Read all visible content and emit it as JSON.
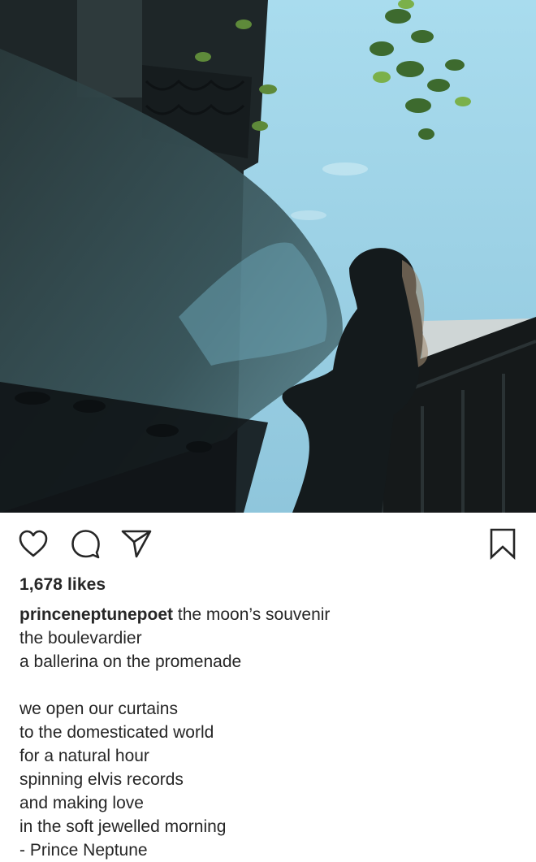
{
  "post": {
    "image_alt": "",
    "likes_text": "1,678 likes",
    "username": "princeneptunepoet",
    "caption_first_line": "the moon’s souvenir",
    "caption_lines_a": [
      "the boulevardier",
      "a ballerina on the promenade"
    ],
    "caption_lines_b": [
      "we open our curtains",
      "to the domesticated world",
      "for a natural hour",
      "spinning elvis records",
      "and making love",
      "in the soft jewelled morning",
      "- Prince Neptune"
    ]
  },
  "actions": {
    "icons": [
      "heart-icon",
      "comment-icon",
      "share-icon",
      "bookmark-icon"
    ]
  },
  "colors": {
    "text": "#262626",
    "sky": "#9fd3e6",
    "silhouette": "#141a1c"
  }
}
